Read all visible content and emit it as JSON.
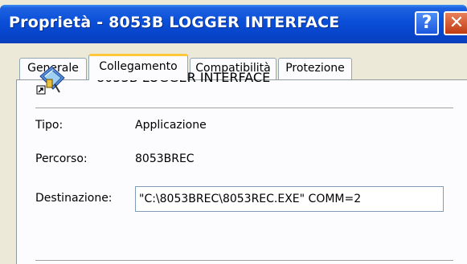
{
  "window": {
    "title": "Proprietà - 8053B LOGGER INTERFACE",
    "help_label": "?",
    "close_label": "✕"
  },
  "tabs": [
    {
      "label": "Generale",
      "active": false
    },
    {
      "label": "Collegamento",
      "active": true
    },
    {
      "label": "Compatibilità",
      "active": false
    },
    {
      "label": "Protezione",
      "active": false
    }
  ],
  "shortcut": {
    "icon": "program-shortcut-icon",
    "name": "8053B LOGGER INTERFACE",
    "type_label": "Tipo:",
    "type_value": "Applicazione",
    "path_label": "Percorso:",
    "path_value": "8053BREC",
    "target_label": "Destinazione:",
    "target_value": "\"C:\\8053BREC\\8053REC.EXE\" COMM=2"
  },
  "colors": {
    "titlebar": "#0a4ed8",
    "active_tab_accent": "#ffc83c",
    "dialog_bg": "#ece9d8",
    "close_button": "#c13b12"
  }
}
